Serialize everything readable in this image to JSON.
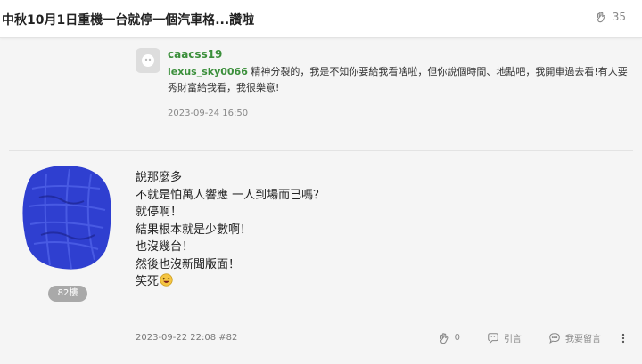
{
  "thread": {
    "title": "中秋10月1日重機一台就停一個汽車格...讚啦",
    "clap_count": "35"
  },
  "reply": {
    "author": "caacss19",
    "mention": "lexus_sky0066",
    "text": " 精神分裂的，我是不知你要給我看啥啦，但你說個時間、地點吧，我開車過去看!有人要秀財富給我看，我很樂意!",
    "time": "2023-09-24 16:50"
  },
  "post": {
    "floor": "82樓",
    "lines": [
      "說那麼多",
      "不就是怕萬人響應 一人到場而已嗎？",
      "就停啊！",
      "結果根本就是少數啊！",
      "也沒幾台！",
      "然後也沒新聞版面！",
      "笑死"
    ],
    "meta": "2023-09-22 22:08 #82",
    "actions": {
      "clap_count": "0",
      "quote_label": "引言",
      "comment_label": "我要留言"
    }
  },
  "colors": {
    "accent_green": "#3b8f3b",
    "avatar_scribble": "#2f3fd0"
  },
  "icons": [
    "clap-icon",
    "quote-icon",
    "comment-icon",
    "more-icon",
    "laughing-emoji-icon"
  ]
}
